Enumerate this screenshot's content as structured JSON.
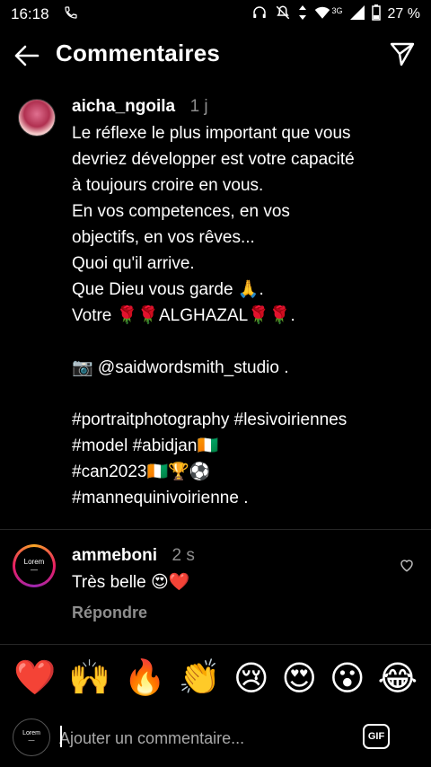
{
  "status": {
    "time": "16:18",
    "battery": "27 %",
    "network": "3G"
  },
  "header": {
    "title": "Commentaires"
  },
  "caption": {
    "username": "aicha_ngoila",
    "time": "1 j",
    "lines": [
      "Le réflexe le plus important que vous",
      "devriez développer est votre capacité",
      "à toujours croire en vous.",
      "En vos competences, en vos",
      "objectifs, en vos rêves...",
      "Quoi qu'il arrive.",
      "Que Dieu vous garde 🙏.",
      "Votre 🌹🌹ALGHAZAL🌹🌹.",
      "",
      "📷 @saidwordsmith_studio .",
      "",
      "#portraitphotography #lesivoiriennes",
      "#model #abidjan🇨🇮",
      "#can2023🇨🇮🏆⚽",
      "#mannequinivoirienne ."
    ]
  },
  "comment": {
    "username": "ammeboni",
    "time": "2 s",
    "text": "Très belle 😍❤️",
    "reply_label": "Répondre",
    "avatar_text": [
      "Lorem",
      "—"
    ]
  },
  "emoji_reactions": [
    "❤️",
    "🙌",
    "🔥",
    "👏",
    "😢",
    "😍",
    "😮",
    "😂"
  ],
  "input": {
    "placeholder": "Ajouter un commentaire...",
    "gif_label": "GIF",
    "avatar_text": [
      "Lorem",
      "—"
    ]
  }
}
